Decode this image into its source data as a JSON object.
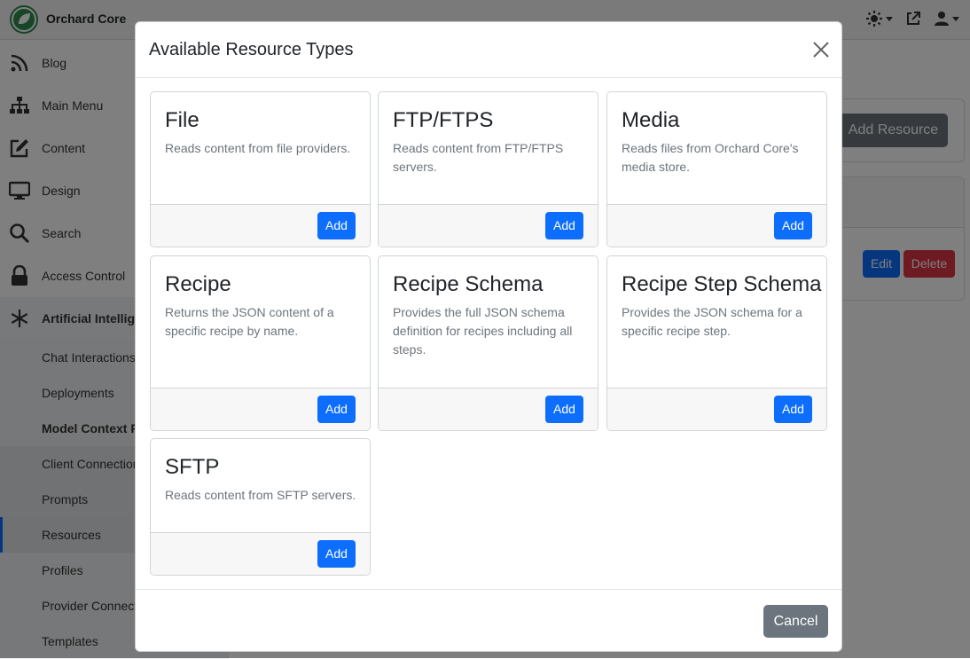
{
  "app": {
    "name": "Orchard Core"
  },
  "sidebar": {
    "items": [
      {
        "label": "Blog",
        "icon": "rss-icon"
      },
      {
        "label": "Main Menu",
        "icon": "sitemap-icon"
      },
      {
        "label": "Content",
        "icon": "edit-icon"
      },
      {
        "label": "Design",
        "icon": "monitor-icon"
      },
      {
        "label": "Search",
        "icon": "search-icon"
      },
      {
        "label": "Access Control",
        "icon": "lock-icon"
      },
      {
        "label": "Artificial Intellige",
        "icon": "snowflake-icon"
      }
    ],
    "subitems": [
      {
        "label": "Chat Interactions"
      },
      {
        "label": "Deployments"
      },
      {
        "label": "Model Context P"
      },
      {
        "label": "Client Connection"
      },
      {
        "label": "Prompts"
      },
      {
        "label": "Resources"
      },
      {
        "label": "Profiles"
      },
      {
        "label": "Provider Connect"
      },
      {
        "label": "Templates"
      }
    ]
  },
  "main": {
    "add_resource_label": "Add Resource",
    "edit_label": "Edit",
    "delete_label": "Delete"
  },
  "modal": {
    "title": "Available Resource Types",
    "cancel_label": "Cancel",
    "cards": [
      {
        "title": "File",
        "description": "Reads content from file providers.",
        "button": "Add"
      },
      {
        "title": "FTP/FTPS",
        "description": "Reads content from FTP/FTPS servers.",
        "button": "Add"
      },
      {
        "title": "Media",
        "description": "Reads files from Orchard Core's media store.",
        "button": "Add"
      },
      {
        "title": "Recipe",
        "description": "Returns the JSON content of a specific recipe by name.",
        "button": "Add"
      },
      {
        "title": "Recipe Schema",
        "description": "Provides the full JSON schema definition for recipes including all steps.",
        "button": "Add"
      },
      {
        "title": "Recipe Step Schema",
        "description": "Provides the JSON schema for a specific recipe step.",
        "button": "Add"
      },
      {
        "title": "SFTP",
        "description": "Reads content from SFTP servers.",
        "button": "Add"
      }
    ]
  },
  "colors": {
    "primary": "#0d6efd",
    "secondary": "#6c757d",
    "danger": "#dc3545",
    "brand": "#2d8a4e"
  }
}
